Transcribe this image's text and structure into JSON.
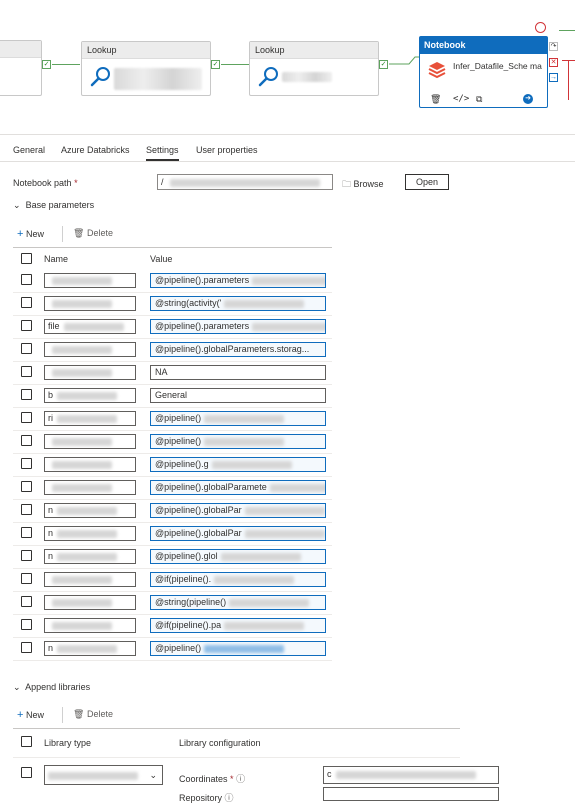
{
  "canvas": {
    "lookup1_title": "Lookup",
    "lookup2_title": "Lookup",
    "notebook": {
      "header": "Notebook",
      "name": "Infer_Datafile_Sche ma"
    }
  },
  "tabs": [
    "General",
    "Azure Databricks",
    "Settings",
    "User properties"
  ],
  "notebook_path": {
    "label": "Notebook path",
    "value": "/",
    "browse": "Browse",
    "open": "Open"
  },
  "base_parameters": {
    "section": "Base parameters",
    "new": "New",
    "delete": "Delete",
    "col_name": "Name",
    "col_value": "Value",
    "rows": [
      {
        "name": "",
        "value": "@pipeline().parameters"
      },
      {
        "name": "",
        "value": "@string(activity('"
      },
      {
        "name": "file",
        "value": "@pipeline().parameters"
      },
      {
        "name": "",
        "value": "@pipeline().globalParameters.storag..."
      },
      {
        "name": "",
        "value": "NA"
      },
      {
        "name": "b",
        "value": "General"
      },
      {
        "name": "ri",
        "value": "@pipeline()"
      },
      {
        "name": "",
        "value": "@pipeline()"
      },
      {
        "name": "",
        "value": "@pipeline().g"
      },
      {
        "name": "",
        "value": "@pipeline().globalParamete"
      },
      {
        "name": "n",
        "value": "@pipeline().globalPar"
      },
      {
        "name": "n",
        "value": "@pipeline().globalPar"
      },
      {
        "name": "n",
        "value": "@pipeline().glol"
      },
      {
        "name": "",
        "value": "@if(pipeline()."
      },
      {
        "name": "",
        "value": "@string(pipeline()"
      },
      {
        "name": "",
        "value": "@if(pipeline().pa"
      },
      {
        "name": "n",
        "value": "@pipeline()"
      }
    ]
  },
  "append_libraries": {
    "section": "Append libraries",
    "new": "New",
    "delete": "Delete",
    "col_type": "Library type",
    "col_config": "Library configuration",
    "coordinates_label": "Coordinates",
    "repository_label": "Repository",
    "coordinates_value": "c"
  },
  "colors": {
    "accent": "#0f6cbd",
    "success": "#5ea35e",
    "error": "#a4262c"
  }
}
